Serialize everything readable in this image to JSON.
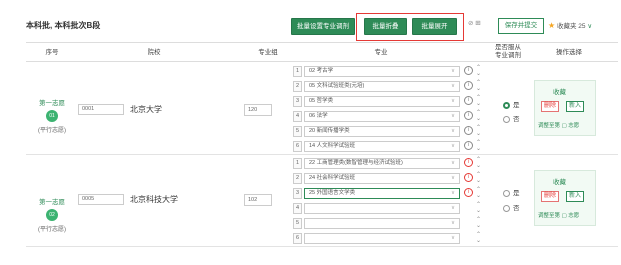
{
  "header": {
    "title": "本科批, 本科批次B段",
    "btn_set_major": "批量设置专业调剂",
    "btn_collapse": "批量折叠",
    "btn_expand": "批量展开",
    "tool_text": "⊘ ⊞",
    "btn_save_submit": "保存并提交",
    "fav_text": "收藏夹 25"
  },
  "columns": {
    "seq": "序号",
    "school": "院校",
    "group": "专业组",
    "major": "专业",
    "obey_line1": "是否服从",
    "obey_line2": "专业调剂",
    "ops": "操作选择"
  },
  "rows": [
    {
      "seq_label": "第一志愿",
      "seq_num": "01",
      "seq_sub": "(平行志愿)",
      "code": "0001",
      "university": "北京大学",
      "group": "120",
      "majors": [
        {
          "num": "1",
          "text": "02 考古学"
        },
        {
          "num": "2",
          "text": "05 文科试验班类(元培)"
        },
        {
          "num": "3",
          "text": "05 哲学类"
        },
        {
          "num": "4",
          "text": "06 法学"
        },
        {
          "num": "5",
          "text": "20 新闻传播学类"
        },
        {
          "num": "6",
          "text": "14 人文科学试验班"
        }
      ],
      "obey_yes": "是",
      "obey_no": "否",
      "op_fav": "收藏",
      "op_del": "删除",
      "op_add": "新入",
      "op_adjust": "调整至第",
      "op_adjust_go": "志愿"
    },
    {
      "seq_label": "第一志愿",
      "seq_num": "02",
      "seq_sub": "(平行志愿)",
      "code": "0005",
      "university": "北京科技大学",
      "group": "102",
      "majors": [
        {
          "num": "1",
          "text": "22 工商管理类(数智管理与经济试验班)"
        },
        {
          "num": "2",
          "text": "24 社会科学试验班"
        },
        {
          "num": "3",
          "text": "25 外国语言文学类"
        },
        {
          "num": "4",
          "text": ""
        },
        {
          "num": "5",
          "text": ""
        },
        {
          "num": "6",
          "text": ""
        }
      ],
      "obey_yes": "是",
      "obey_no": "否",
      "op_fav": "收藏",
      "op_del": "删除",
      "op_add": "新入",
      "op_adjust": "调整至第",
      "op_adjust_go": "志愿"
    }
  ]
}
